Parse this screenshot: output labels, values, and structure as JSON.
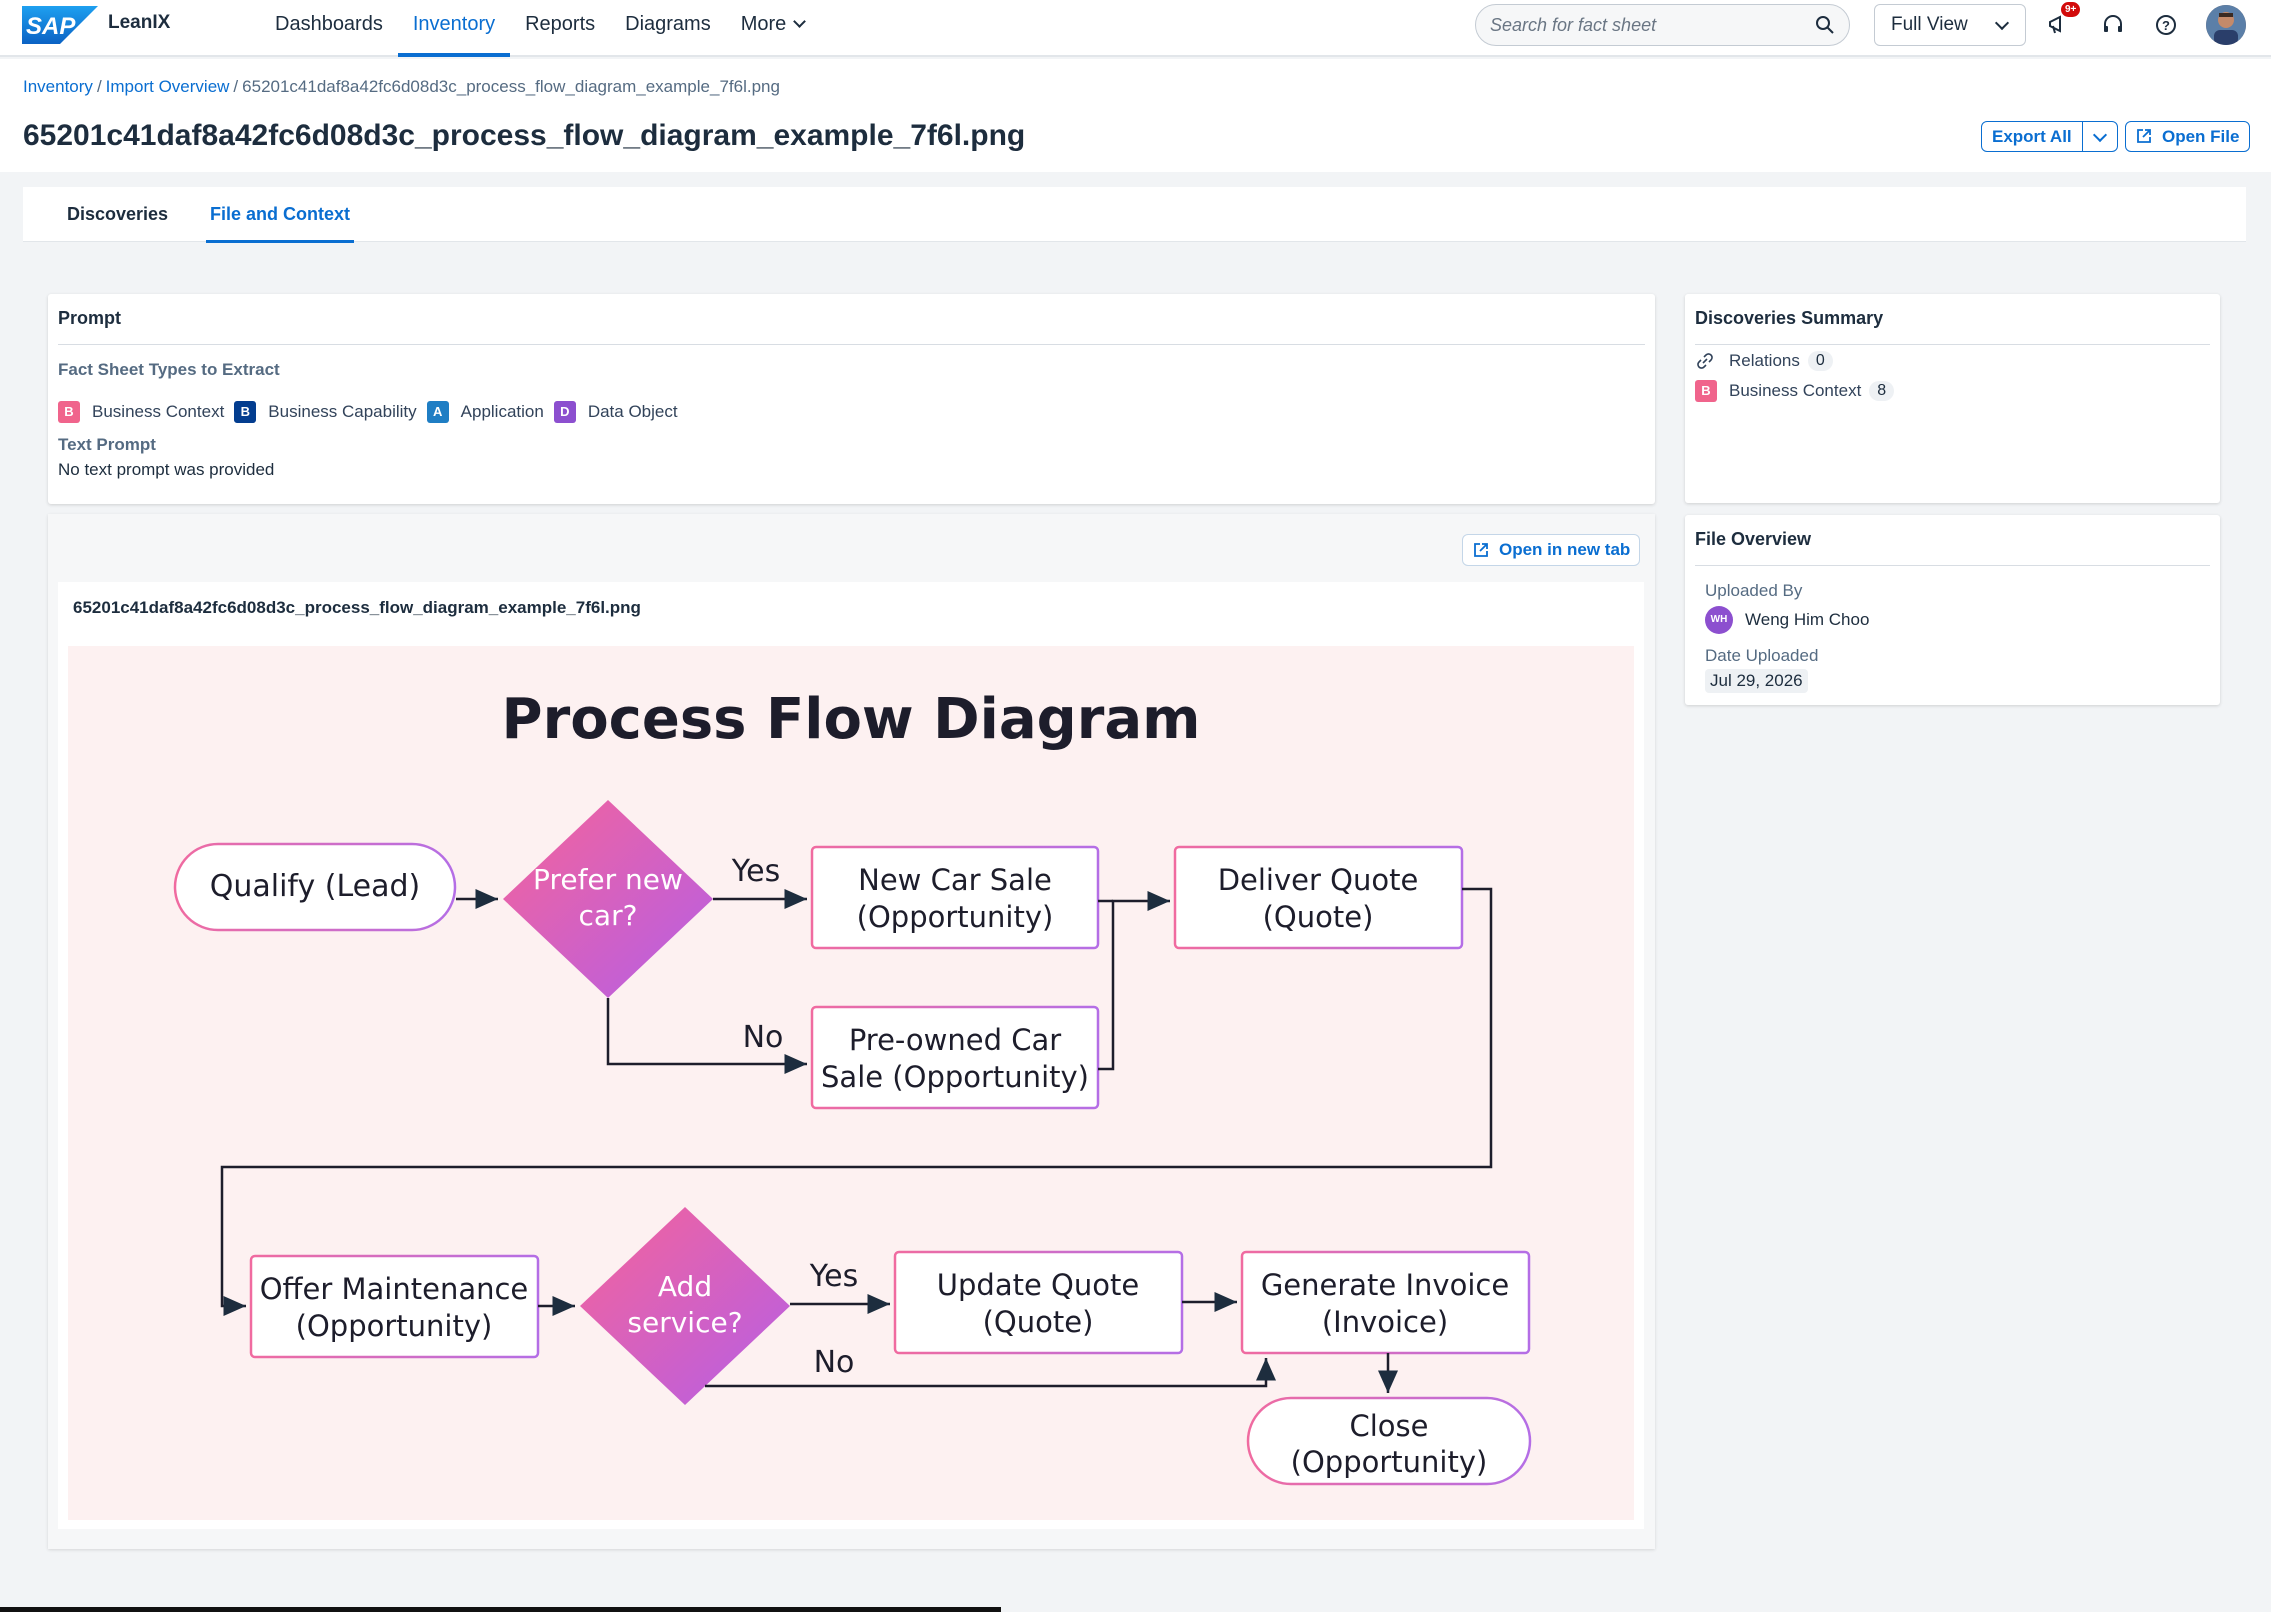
{
  "app": {
    "name": "LeanIX"
  },
  "nav": {
    "items": [
      "Dashboards",
      "Inventory",
      "Reports",
      "Diagrams",
      "More"
    ],
    "active": "Inventory"
  },
  "search": {
    "placeholder": "Search for fact sheet"
  },
  "view_select": {
    "value": "Full View"
  },
  "notifications": {
    "badge": "9+"
  },
  "breadcrumb": {
    "items": [
      "Inventory",
      "Import Overview"
    ],
    "current": "65201c41daf8a42fc6d08d3c_process_flow_diagram_example_7f6l.png",
    "separator": "/"
  },
  "page": {
    "title": "65201c41daf8a42fc6d08d3c_process_flow_diagram_example_7f6l.png",
    "export_label": "Export All",
    "open_file_label": "Open File"
  },
  "tabs": {
    "items": [
      "Discoveries",
      "File and Context"
    ],
    "active": "File and Context"
  },
  "prompt": {
    "title": "Prompt",
    "types_label": "Fact Sheet Types to Extract",
    "types": [
      {
        "letter": "B",
        "label": "Business Context",
        "color": "#f0648c"
      },
      {
        "letter": "B",
        "label": "Business Capability",
        "color": "#033d8f"
      },
      {
        "letter": "A",
        "label": "Application",
        "color": "#1f7ec4"
      },
      {
        "letter": "D",
        "label": "Data Object",
        "color": "#8c4fcf"
      }
    ],
    "text_prompt_label": "Text Prompt",
    "text_prompt_value": "No text prompt was provided"
  },
  "summary": {
    "title": "Discoveries Summary",
    "relations_label": "Relations",
    "relations_count": "0",
    "business_context_letter": "B",
    "business_context_label": "Business Context",
    "business_context_count": "8"
  },
  "file_overview": {
    "title": "File Overview",
    "uploaded_by_label": "Uploaded By",
    "uploader_initials": "WH",
    "uploader_name": "Weng Him Choo",
    "date_label": "Date Uploaded",
    "date_value": "Jul 29, 2026"
  },
  "preview": {
    "open_tab_label": "Open in new tab",
    "file_name": "65201c41daf8a42fc6d08d3c_process_flow_diagram_example_7f6l.png"
  },
  "diagram": {
    "title": "Process Flow Diagram",
    "qualify": "Qualify (Lead)",
    "decision1": [
      "Prefer new",
      "car?"
    ],
    "yes1": "Yes",
    "no1": "No",
    "new_car": [
      "New Car Sale",
      "(Opportunity)"
    ],
    "preowned": [
      "Pre-owned Car",
      "Sale (Opportunity)"
    ],
    "deliver": [
      "Deliver Quote",
      "(Quote)"
    ],
    "offer": [
      "Offer Maintenance",
      "(Opportunity)"
    ],
    "decision2": [
      "Add",
      "service?"
    ],
    "yes2": "Yes",
    "no2": "No",
    "update": [
      "Update Quote",
      "(Quote)"
    ],
    "invoice": [
      "Generate Invoice",
      "(Invoice)"
    ],
    "close": [
      "Close",
      "(Opportunity)"
    ]
  },
  "colors": {
    "accent": "#0a6ed1",
    "diagram_bg": "#fdf1f1",
    "node_pink": "#f06ba0",
    "node_purple": "#b46ee6"
  }
}
